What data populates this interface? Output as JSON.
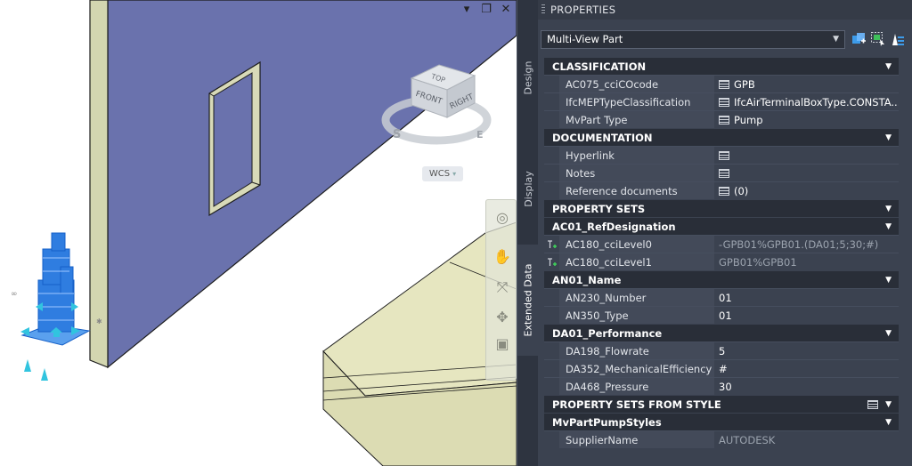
{
  "viewport": {
    "window_controls": [
      "▾",
      "❐",
      "✕"
    ],
    "viewcube": {
      "top": "TOP",
      "front": "FRONT",
      "right": "RIGHT",
      "compass_s": "S",
      "compass_e": "E"
    },
    "wcs_label": "WCS"
  },
  "side_tabs": [
    {
      "label": "Design",
      "active": false
    },
    {
      "label": "Display",
      "active": false
    },
    {
      "label": "Extended Data",
      "active": true
    }
  ],
  "palette": {
    "title": "PROPERTIES",
    "object_type": "Multi-View Part",
    "sections": {
      "classification": {
        "header": "CLASSIFICATION",
        "rows": [
          {
            "name": "AC075_cciCOcode",
            "value": "GPB"
          },
          {
            "name": "IfcMEPTypeClassification",
            "value": "IfcAirTerminalBoxType.CONSTA..."
          },
          {
            "name": "MvPart Type",
            "value": "Pump"
          }
        ]
      },
      "documentation": {
        "header": "DOCUMENTATION",
        "rows": [
          {
            "name": "Hyperlink",
            "value": ""
          },
          {
            "name": "Notes",
            "value": ""
          },
          {
            "name": "Reference documents",
            "value": "(0)"
          }
        ]
      },
      "property_sets": {
        "header": "PROPERTY SETS",
        "ac01": {
          "header": "AC01_RefDesignation",
          "rows": [
            {
              "name": "AC180_cciLevel0",
              "value": "-GPB01%GPB01.(DA01;5;30;#)"
            },
            {
              "name": "AC180_cciLevel1",
              "value": "GPB01%GPB01"
            }
          ]
        },
        "an01": {
          "header": "AN01_Name",
          "rows": [
            {
              "name": "AN230_Number",
              "value": "01"
            },
            {
              "name": "AN350_Type",
              "value": "01"
            }
          ]
        },
        "da01": {
          "header": "DA01_Performance",
          "rows": [
            {
              "name": "DA198_Flowrate",
              "value": "5"
            },
            {
              "name": "DA352_MechanicalEfficiency",
              "value": "#"
            },
            {
              "name": "DA468_Pressure",
              "value": "30"
            }
          ]
        }
      },
      "from_style": {
        "header": "PROPERTY SETS FROM STYLE",
        "mvpart": {
          "header": "MvPartPumpStyles",
          "rows": [
            {
              "name": "SupplierName",
              "value": "AUTODESK"
            }
          ]
        }
      }
    }
  },
  "colors": {
    "wall_face": "#6a72ad",
    "wall_edge": "#d3d6b0",
    "slab": "#e6e6c0",
    "pump": "#2f7de0",
    "grip": "#31c4df",
    "palette_bg": "#3b4250",
    "section_bg": "#292e38"
  }
}
